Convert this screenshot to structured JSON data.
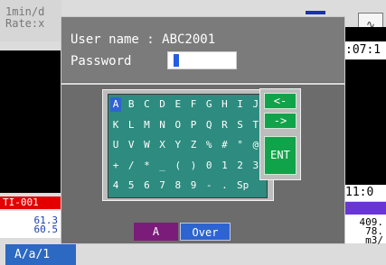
{
  "background": {
    "top_left": [
      "1min/d",
      "Rate:x"
    ],
    "red_label": "TI-001",
    "left_values": [
      "61.3",
      "60.5"
    ],
    "bottom_tab": "A/a/1",
    "right_time_top": ":07:1",
    "right_time_bottom": "11:0",
    "right_values": [
      "409.",
      "78.",
      "m3/"
    ]
  },
  "dialog": {
    "user_label": "User name : ABC2001",
    "password_label": "Password",
    "keys": [
      [
        "A",
        "B",
        "C",
        "D",
        "E",
        "F",
        "G",
        "H",
        "I",
        "J"
      ],
      [
        "K",
        "L",
        "M",
        "N",
        "O",
        "P",
        "Q",
        "R",
        "S",
        "T"
      ],
      [
        "U",
        "V",
        "W",
        "X",
        "Y",
        "Z",
        "%",
        "#",
        "°",
        "@"
      ],
      [
        "+",
        "/",
        "*",
        "_",
        "(",
        ")",
        "0",
        "1",
        "2",
        "3"
      ],
      [
        "4",
        "5",
        "6",
        "7",
        "8",
        "9",
        "-",
        ".",
        "Sp"
      ]
    ],
    "selected_key": "A",
    "functions": {
      "back": "<-",
      "forward": "->",
      "enter": "ENT"
    },
    "mode_left": "A",
    "mode_right": "Over"
  },
  "colors": {
    "dialog": "#6c6c6c",
    "keypad": "#2d8b7f",
    "selected_key": "#2f63d3",
    "function_keys": "#11a34a",
    "mode_left": "#7c1c7a",
    "mode_right": "#2d64cf"
  }
}
